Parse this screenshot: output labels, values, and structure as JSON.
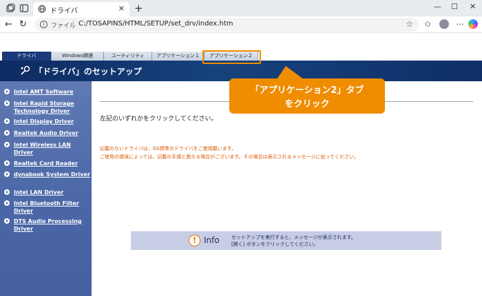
{
  "browser": {
    "tab_title": "ドライバ",
    "tab_close": "✕",
    "new_tab": "+",
    "window_controls": [
      "—",
      "☐",
      "✕"
    ],
    "nav": {
      "back": "←",
      "refresh": "↻"
    },
    "address": {
      "scheme_label": "ファイル",
      "url": "C:/TOSAPINS/HTML/SETUP/set_drv/index.htm",
      "info_glyph": "i"
    },
    "icons": [
      "tab-actions-icon",
      "vertical-tabs-icon",
      "globe-icon",
      "favorites-star-icon",
      "collections-icon",
      "profile-icon",
      "more-icon",
      "copilot-icon"
    ]
  },
  "page": {
    "tabs": [
      {
        "label": "ドライバ"
      },
      {
        "label": "Windows関連"
      },
      {
        "label": "ユーティリティ"
      },
      {
        "label": "アプリケーション１"
      },
      {
        "label": "アプリケーション２"
      }
    ],
    "header_title": "「ドライバ」のセットアップ",
    "sidebar": [
      {
        "label": "Intel AMT Software"
      },
      {
        "label": "Intel Rapid Storage Technology Driver"
      },
      {
        "label": "Intel Display Driver"
      },
      {
        "label": "Realtek Audio Driver"
      },
      {
        "label": "Intel Wireless LAN Driver"
      },
      {
        "label": "Realtek Card Reader"
      },
      {
        "label": "dynabook System Driver"
      },
      {
        "label": "Intel LAN Driver"
      },
      {
        "label": "Intel Bluetooth Filter Driver"
      },
      {
        "label": "DTS Audio Processing Driver"
      }
    ],
    "instruction": "左記のいずれかをクリックしてください。",
    "notes": [
      "記載のないドライバは、OS標準のドライバをご使用願います。",
      "ご使用の環境によっては、記載の手順と異なる場合がございます。その場合は表示されるメッセージに従ってください。"
    ],
    "info": {
      "label": "Info",
      "glyph": "!",
      "lines": [
        "セットアップを実行すると、メッセージが表示されます。",
        "[開く] ボタンをクリックしてください。"
      ]
    }
  },
  "callout": {
    "lines": [
      "「アプリケーション2」タブ",
      "をクリック"
    ]
  },
  "colors": {
    "accent_orange": "#f08c00",
    "header_navy": "#16427c",
    "sidebar_blue": "#4a66a6",
    "note_orange": "#d95a00",
    "info_box": "#c8cde6"
  }
}
